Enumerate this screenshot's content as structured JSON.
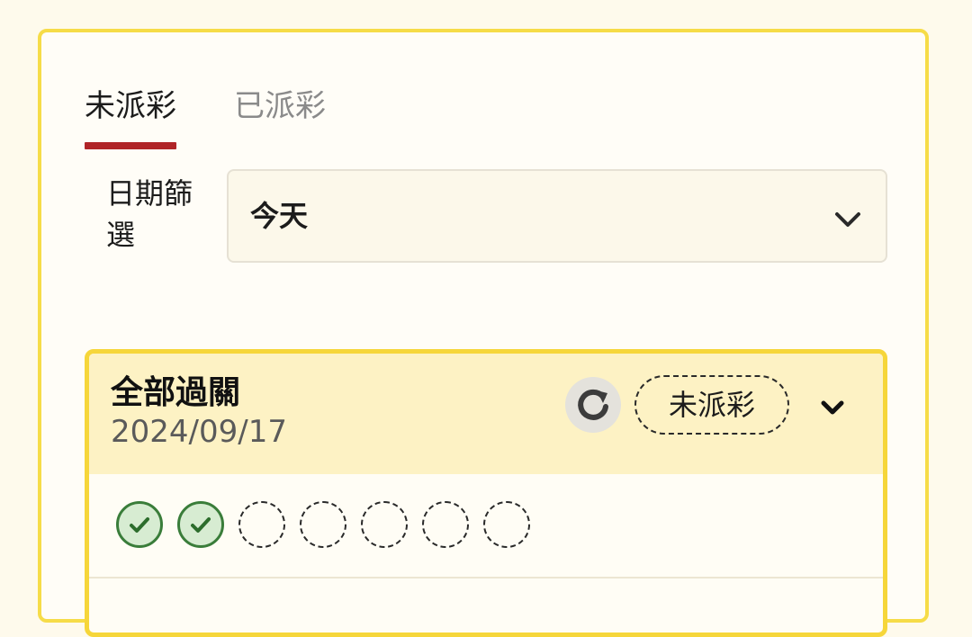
{
  "tabs": [
    {
      "label": "未派彩",
      "active": true
    },
    {
      "label": "已派彩",
      "active": false
    }
  ],
  "filter": {
    "label": "日期篩選",
    "selected": "今天"
  },
  "card": {
    "title": "全部過關",
    "date": "2024/09/17",
    "status": "未派彩",
    "legs": [
      "won",
      "won",
      "pending",
      "pending",
      "pending",
      "pending",
      "pending"
    ]
  },
  "colors": {
    "accent_underline": "#b02428",
    "panel_border": "#f6dc48",
    "card_header_bg": "#fdf2c4",
    "won_green": "#3a7d3a"
  },
  "icons": {
    "select": "chevron-down-icon",
    "refresh": "refresh-icon",
    "expand": "chevron-down-icon",
    "won_leg": "check-circle-icon",
    "pending_leg": "dashed-circle-icon"
  }
}
